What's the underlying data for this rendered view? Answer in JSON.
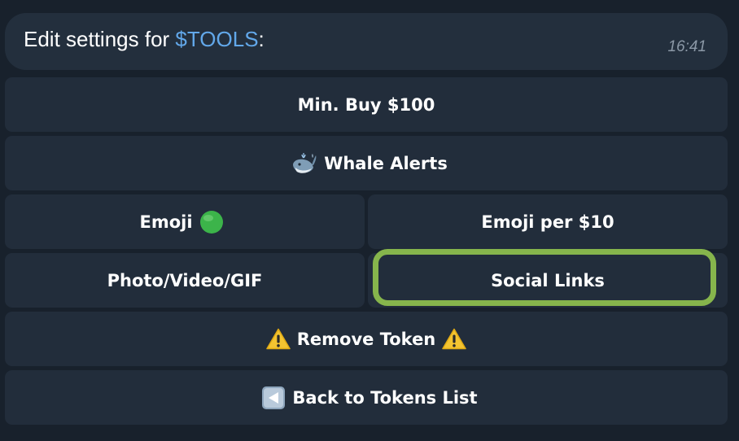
{
  "message": {
    "text_prefix": "Edit settings for ",
    "ticker": "$TOOLS",
    "text_suffix": ":",
    "time": "16:41"
  },
  "buttons": {
    "min_buy": "Min. Buy $100",
    "whale_alerts": "Whale Alerts",
    "emoji": "Emoji",
    "emoji_per": "Emoji per $10",
    "media": "Photo/Video/GIF",
    "social_links": "Social Links",
    "remove_token": "Remove Token",
    "back": "Back to Tokens List"
  },
  "icons": {
    "whale": "whale-icon",
    "emoji_indicator": "green-circle-icon",
    "warning": "warning-icon",
    "back": "back-arrow-icon"
  },
  "colors": {
    "background": "#18212c",
    "button": "#222d3b",
    "ticker": "#62a8ea",
    "highlight": "#86b54c",
    "emoji_green": "#3cb44a"
  }
}
